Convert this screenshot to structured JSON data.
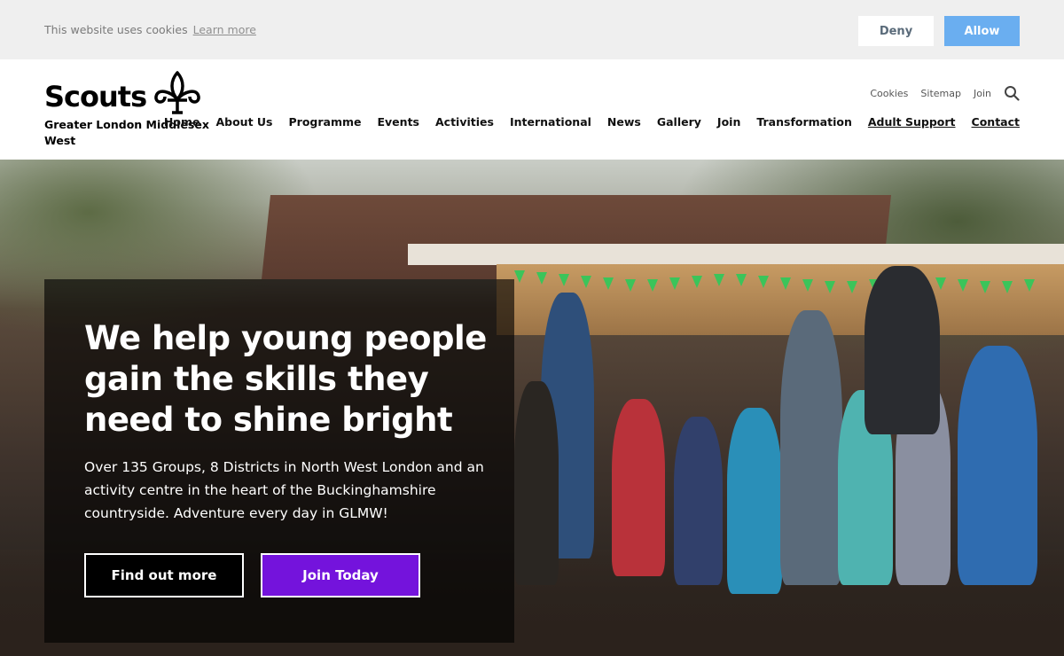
{
  "cookie": {
    "message": "This website uses cookies",
    "learn_more": "Learn more",
    "deny": "Deny",
    "allow": "Allow"
  },
  "brand": {
    "name": "Scouts",
    "subtitle": "Greater London Middlesex West",
    "icon": "fleur-de-lis-icon"
  },
  "utility_nav": [
    "Cookies",
    "Sitemap",
    "Join"
  ],
  "main_nav": [
    "Home",
    "About Us",
    "Programme",
    "Events",
    "Activities",
    "International",
    "News",
    "Gallery",
    "Join",
    "Transformation",
    "Adult Support",
    "Contact"
  ],
  "hero": {
    "title": "We help young people gain the skills they need to shine bright",
    "text": "Over 135 Groups, 8 Districts in North West London and an activity centre in the heart of the Buckinghamshire countryside. Adventure every day in GLMW!",
    "btn_more": "Find out more",
    "btn_join": "Join Today"
  },
  "colors": {
    "purple": "#7413dc",
    "allow_blue": "#6aaef0",
    "cookie_bg": "#efefef"
  }
}
